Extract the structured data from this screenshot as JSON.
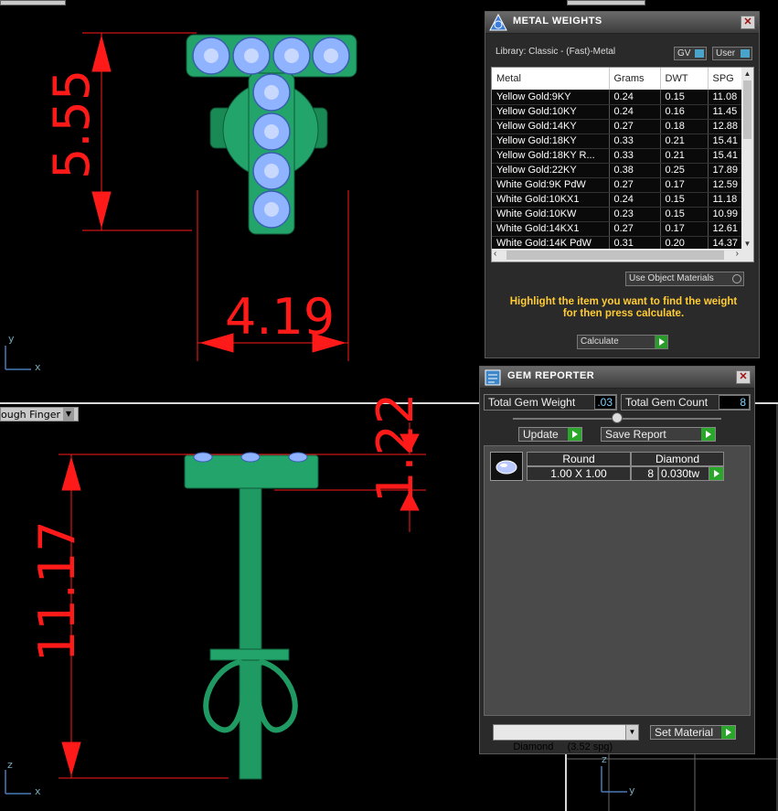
{
  "viewport_top": {
    "dim_height": "5.55",
    "dim_width": "4.19",
    "axis_x": "x",
    "axis_y": "y"
  },
  "viewport_bottom": {
    "label": "ough Finger",
    "dim_height": "11.17",
    "dim_top": "1.22",
    "axis_z": "z",
    "axis_x": "x"
  },
  "viewport_right": {
    "axis_z": "z",
    "axis_y": "y"
  },
  "metal_weights": {
    "title": "METAL WEIGHTS",
    "library": "Library: Classic - (Fast)-Metal",
    "gv_label": "GV",
    "user_label": "User",
    "columns": [
      "Metal",
      "Grams",
      "DWT",
      "SPG"
    ],
    "rows": [
      [
        "Yellow Gold:9KY",
        "0.24",
        "0.15",
        "11.08"
      ],
      [
        "Yellow Gold:10KY",
        "0.24",
        "0.16",
        "11.45"
      ],
      [
        "Yellow Gold:14KY",
        "0.27",
        "0.18",
        "12.88"
      ],
      [
        "Yellow Gold:18KY",
        "0.33",
        "0.21",
        "15.41"
      ],
      [
        "Yellow Gold:18KY R...",
        "0.33",
        "0.21",
        "15.41"
      ],
      [
        "Yellow Gold:22KY",
        "0.38",
        "0.25",
        "17.89"
      ],
      [
        "White Gold:9K PdW",
        "0.27",
        "0.17",
        "12.59"
      ],
      [
        "White Gold:10KX1",
        "0.24",
        "0.15",
        "11.18"
      ],
      [
        "White Gold:10KW",
        "0.23",
        "0.15",
        "10.99"
      ],
      [
        "White Gold:14KX1",
        "0.27",
        "0.17",
        "12.61"
      ],
      [
        "White Gold:14K PdW",
        "0.31",
        "0.20",
        "14.37"
      ]
    ],
    "use_object_materials": "Use Object Materials",
    "hint": "Highlight the item you want to find the weight for then press calculate.",
    "calculate_label": "Calculate"
  },
  "gem_reporter": {
    "title": "GEM REPORTER",
    "total_weight_label": "Total Gem Weight",
    "total_weight_value": ".03",
    "total_count_label": "Total Gem Count",
    "total_count_value": "8",
    "update_label": "Update",
    "save_report_label": "Save Report",
    "gem_headers": [
      "Round",
      "Diamond"
    ],
    "gem_row": {
      "size": "1.00 X 1.00",
      "count": "8",
      "weight": "0.030tw"
    },
    "material_select": "Diamond     (3.52 spg)",
    "set_material_label": "Set Material"
  },
  "colors": {
    "dimension": "#ff1a1a",
    "model_green": "#1f9a63",
    "gem_blue": "#8fb3ff",
    "hint_yellow": "#ffcc33",
    "go_green": "#2aa62a"
  }
}
